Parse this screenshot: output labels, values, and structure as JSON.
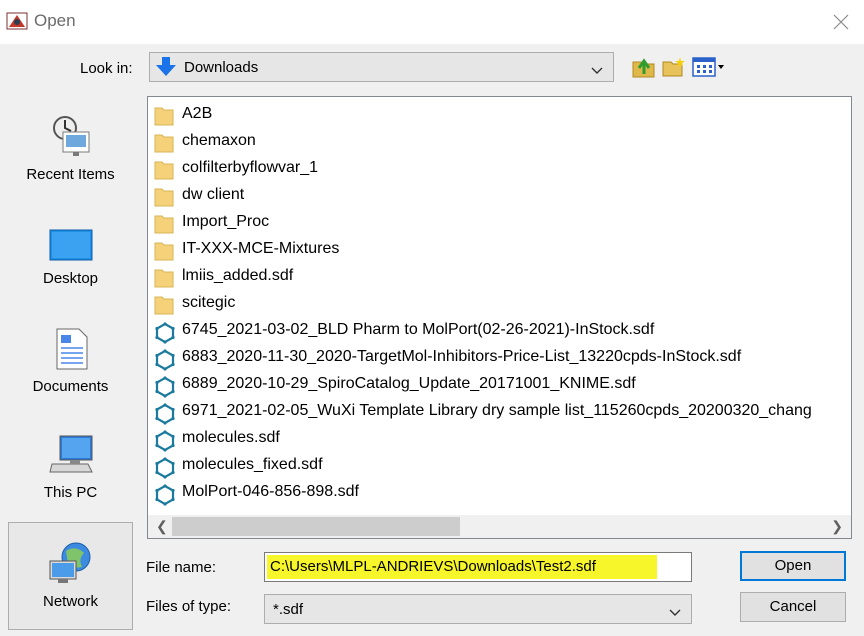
{
  "window": {
    "title": "Open",
    "app_icon": "java-app-icon",
    "close_icon": "close-icon"
  },
  "look_in": {
    "label": "Look in:",
    "value": "Downloads",
    "icon": "downloads-icon"
  },
  "toolbar": {
    "up_icon": "up-folder-icon",
    "new_folder_icon": "new-folder-icon",
    "view_icon": "view-menu-icon"
  },
  "places": [
    {
      "label": "Recent Items",
      "icon": "recent-items-icon"
    },
    {
      "label": "Desktop",
      "icon": "desktop-icon"
    },
    {
      "label": "Documents",
      "icon": "documents-icon"
    },
    {
      "label": "This PC",
      "icon": "this-pc-icon"
    },
    {
      "label": "Network",
      "icon": "network-icon"
    }
  ],
  "files": [
    {
      "name": "A2B",
      "type": "folder"
    },
    {
      "name": "chemaxon",
      "type": "folder"
    },
    {
      "name": "colfilterbyflowvar_1",
      "type": "folder"
    },
    {
      "name": "dw client",
      "type": "folder"
    },
    {
      "name": "Import_Proc",
      "type": "folder"
    },
    {
      "name": "IT-XXX-MCE-Mixtures",
      "type": "folder"
    },
    {
      "name": "lmiis_added.sdf",
      "type": "folder"
    },
    {
      "name": "scitegic",
      "type": "folder"
    },
    {
      "name": "6745_2021-03-02_BLD Pharm to MolPort(02-26-2021)-InStock.sdf",
      "type": "sdf"
    },
    {
      "name": "6883_2020-11-30_2020-TargetMol-Inhibitors-Price-List_13220cpds-InStock.sdf",
      "type": "sdf"
    },
    {
      "name": "6889_2020-10-29_SpiroCatalog_Update_20171001_KNIME.sdf",
      "type": "sdf"
    },
    {
      "name": "6971_2021-02-05_WuXi Template Library dry sample list_115260cpds_20200320_chang",
      "type": "sdf"
    },
    {
      "name": "molecules.sdf",
      "type": "sdf"
    },
    {
      "name": "molecules_fixed.sdf",
      "type": "sdf"
    },
    {
      "name": "MolPort-046-856-898.sdf",
      "type": "sdf"
    }
  ],
  "file_name": {
    "label": "File name:",
    "value": "C:\\Users\\MLPL-ANDRIEVS\\Downloads\\Test2.sdf",
    "highlight_color": "#f6f62a"
  },
  "files_of_type": {
    "label": "Files of type:",
    "value": "*.sdf"
  },
  "buttons": {
    "open": "Open",
    "cancel": "Cancel"
  }
}
